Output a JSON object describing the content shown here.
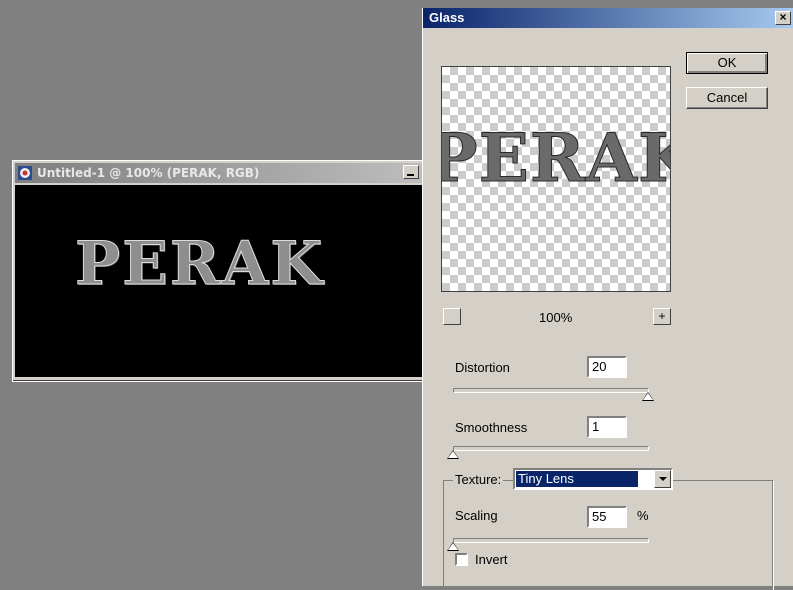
{
  "document": {
    "title": "Untitled-1 @ 100% (PERAK, RGB)",
    "canvas_text": "PERAK"
  },
  "dialog": {
    "title": "Glass",
    "close_label": "×",
    "ok_label": "OK",
    "cancel_label": "Cancel",
    "preview_text": "PERAK",
    "zoom": {
      "minus_label": "",
      "plus_label": "+",
      "value": "100%"
    },
    "distortion": {
      "label": "Distortion",
      "value": "20",
      "slider_fraction": 1.0
    },
    "smoothness": {
      "label": "Smoothness",
      "value": "1",
      "slider_fraction": 0.0
    },
    "texture": {
      "label": "Texture:",
      "selected": "Tiny Lens"
    },
    "scaling": {
      "label": "Scaling",
      "value": "55",
      "unit": "%",
      "slider_fraction": 0.0
    },
    "invert": {
      "label": "Invert",
      "checked": false
    }
  }
}
